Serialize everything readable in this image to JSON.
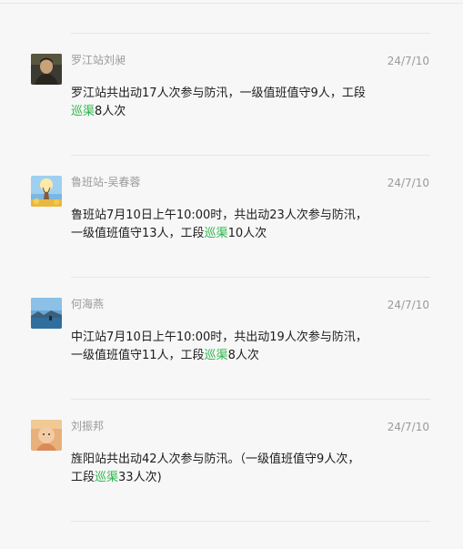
{
  "messages": [
    {
      "sender": "罗江站刘昶",
      "time": "24/7/10",
      "text_before": "罗江站共出动17人次参与防汛，一级值班值守9人，工段",
      "link": "巡渠",
      "text_after": "8人次",
      "avatar_icon": "person-portrait-avatar"
    },
    {
      "sender": "鲁班站-吴春蓉",
      "time": "24/7/10",
      "text_before": "鲁班站7月10日上午10:00时，共出动23人次参与防汛，一级值班值守13人，工段",
      "link": "巡渠",
      "text_after": "10人次",
      "avatar_icon": "deer-landscape-avatar"
    },
    {
      "sender": "何海燕",
      "time": "24/7/10",
      "text_before": "中江站7月10日上午10:00时，共出动19人次参与防汛，一级值班值守11人，工段",
      "link": "巡渠",
      "text_after": "8人次",
      "avatar_icon": "lake-landscape-avatar"
    },
    {
      "sender": "刘振邦",
      "time": "24/7/10",
      "text_before": "旌阳站共出动42人次参与防汛。（一级值班值守9人次，工段",
      "link": "巡渠",
      "text_after": "33人次)",
      "avatar_icon": "baby-photo-avatar"
    }
  ],
  "colors": {
    "link": "#2bb54a",
    "meta": "#9a9a9a",
    "background": "#f7f7f7"
  }
}
